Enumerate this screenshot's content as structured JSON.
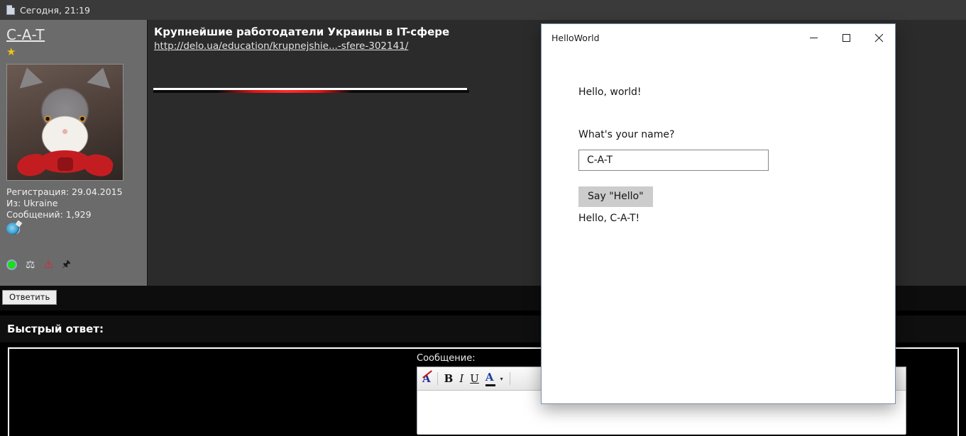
{
  "forum": {
    "post_meta": "Сегодня, 21:19",
    "user": {
      "name": "C-A-T",
      "badge_icon": "star-icon",
      "avatar_alt": "cat-avatar",
      "registration": "Регистрация: 29.04.2015",
      "location": "Из: Ukraine",
      "posts": "Сообщений: 1,929",
      "contact_icon": "icq-icon",
      "status_icons": [
        "online-status-icon",
        "scales-icon",
        "warning-icon",
        "paperclip-icon"
      ],
      "scales_glyph": "⚖",
      "warning_glyph": "⚠",
      "paperclip_glyph": "🖈",
      "star_glyph": "★"
    },
    "post": {
      "title": "Крупнейшие работодатели Украины в IT-сфере",
      "url": "http://delo.ua/education/krupnejshie...-sfere-302141/"
    },
    "reply_button": "Ответить",
    "quick_reply_title": "Быстрый ответ:",
    "editor": {
      "message_label": "Сообщение:",
      "toolbar": [
        {
          "name": "remove-format-icon",
          "glyph": "A"
        },
        {
          "name": "bold-icon",
          "glyph": "B"
        },
        {
          "name": "italic-icon",
          "glyph": "I"
        },
        {
          "name": "underline-icon",
          "glyph": "U"
        },
        {
          "name": "font-color-icon",
          "glyph": "A"
        },
        {
          "name": "chevron-down-icon",
          "glyph": "▾"
        }
      ]
    }
  },
  "dialog": {
    "title": "HelloWorld",
    "minimize_label": "−",
    "maximize_label": "□",
    "close_label": "✕",
    "hello_world_text": "Hello, world!",
    "name_question": "What's your name?",
    "name_value": "C-A-T",
    "name_placeholder": "",
    "say_hello_label": "Say \"Hello\"",
    "greeting": "Hello, C-A-T!"
  },
  "colors": {
    "user_panel": "#6b6b6b",
    "post_body": "#2b2b2b",
    "meta_bar": "#3a3a3a",
    "accent_red": "#e01515",
    "dialog_border": "#7a91ab",
    "button_gray": "#cccccc"
  }
}
